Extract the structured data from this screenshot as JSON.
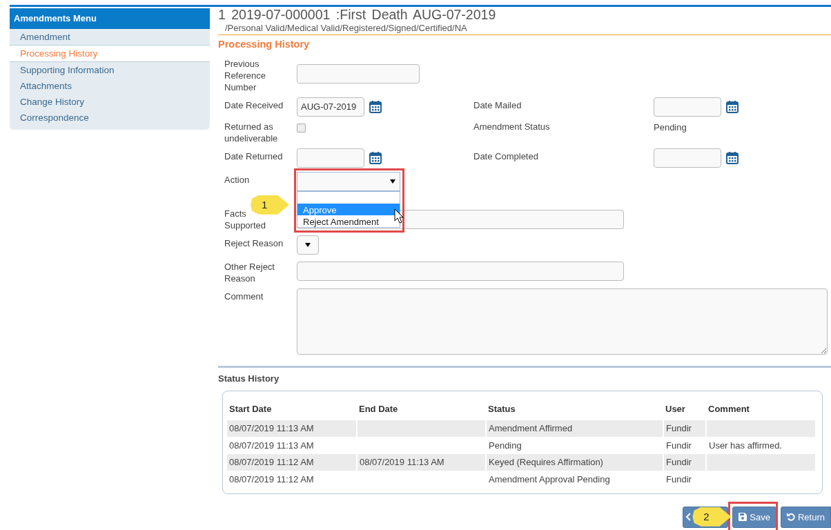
{
  "sidebar": {
    "title": "Amendments Menu",
    "items": [
      {
        "label": "Amendment",
        "selected": false
      },
      {
        "label": "Processing History",
        "selected": true
      },
      {
        "label": "Supporting Information",
        "selected": false
      },
      {
        "label": "Attachments",
        "selected": false
      },
      {
        "label": "Change History",
        "selected": false
      },
      {
        "label": "Correspondence",
        "selected": false
      }
    ]
  },
  "header": {
    "title": "1 2019-07-000001 :First Death AUG-07-2019",
    "subtitle": "/Personal Valid/Medical Valid/Registered/Signed/Certified/NA"
  },
  "section_title": "Processing History",
  "form": {
    "rows": [
      [
        {
          "label": "Previous Reference Number",
          "kind": "text"
        }
      ],
      [
        {
          "label": "Date Received",
          "kind": "date",
          "value": "AUG-07-2019"
        },
        {
          "label": "Date Mailed",
          "kind": "date"
        }
      ],
      [
        {
          "label": "Returned as undeliverable",
          "kind": "checkbox",
          "checked": false
        },
        {
          "label": "Amendment Status",
          "kind": "static",
          "value": "Pending"
        }
      ],
      [
        {
          "label": "Date Returned",
          "kind": "date"
        },
        {
          "label": "Date Completed",
          "kind": "date"
        }
      ],
      [
        {
          "label": "Action",
          "kind": "dropdown",
          "expanded": true,
          "highlighted": true,
          "callout": "1",
          "options": [
            {
              "label": "Approve",
              "selected": true
            },
            {
              "label": "Reject Amendment",
              "selected": false
            }
          ]
        }
      ],
      [
        {
          "label": "Facts Supported",
          "kind": "wide"
        }
      ],
      [
        {
          "label": "Reject Reason",
          "kind": "select"
        }
      ],
      [
        {
          "label": "Other Reject Reason",
          "kind": "wide"
        }
      ],
      [
        {
          "label": "Comment",
          "kind": "textarea"
        }
      ]
    ]
  },
  "status_history": {
    "title": "Status History",
    "columns": [
      "Start Date",
      "End Date",
      "Status",
      "User",
      "Comment"
    ],
    "rows": [
      [
        "08/07/2019 11:13 AM",
        null,
        "Amendment Affirmed",
        "Fundir",
        null
      ],
      [
        "08/07/2019 11:13 AM",
        null,
        "Pending",
        "Fundir",
        "User has affirmed."
      ],
      [
        "08/07/2019 11:12 AM",
        "08/07/2019 11:13 AM",
        "Keyed (Requires Affirmation)",
        "Fundir",
        null
      ],
      [
        "08/07/2019 11:12 AM",
        null,
        "Amendment Approval Pending",
        "Fundir",
        null
      ]
    ]
  },
  "buttons": [
    {
      "kind": "back"
    },
    {
      "kind": "save",
      "label": "Save",
      "highlighted": true,
      "callout": "2"
    },
    {
      "kind": "return",
      "label": "Return"
    }
  ]
}
